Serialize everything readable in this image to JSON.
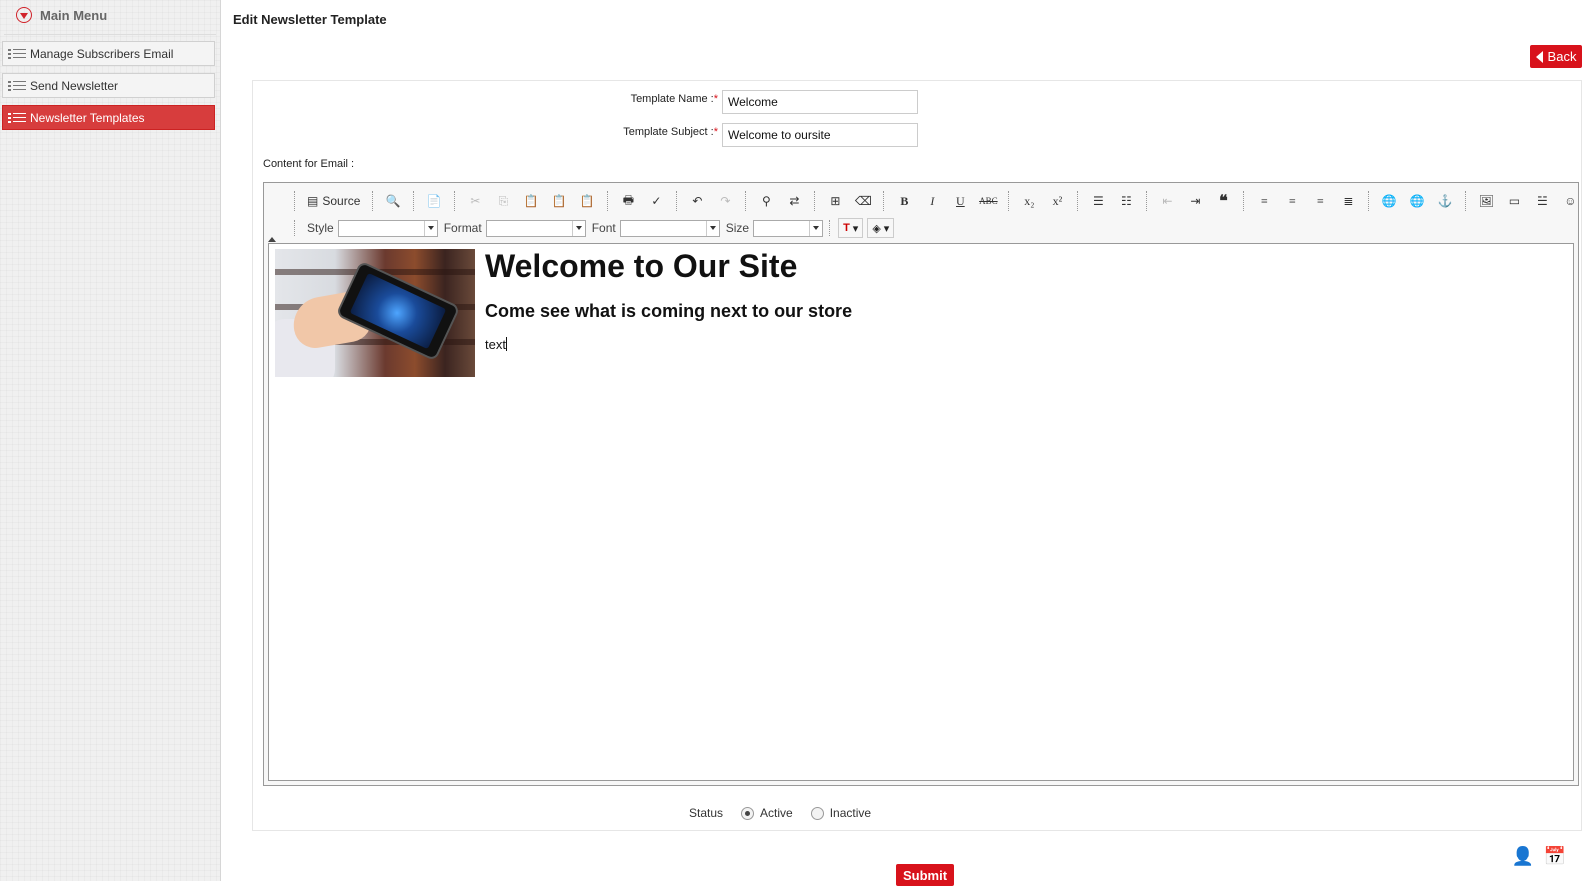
{
  "sidebar": {
    "title": "Main Menu",
    "items": [
      {
        "label": "Manage Subscribers Email",
        "active": false
      },
      {
        "label": "Send Newsletter",
        "active": false
      },
      {
        "label": "Newsletter Templates",
        "active": true
      }
    ]
  },
  "page": {
    "title": "Edit Newsletter Template",
    "back_label": "Back"
  },
  "form": {
    "template_name_label": "Template Name :",
    "template_name_value": "Welcome",
    "template_subject_label": "Template Subject :",
    "template_subject_value": "Welcome to oursite",
    "required_mark": "*",
    "content_label": "Content for Email :"
  },
  "editor": {
    "source_label": "Source",
    "style_label": "Style",
    "format_label": "Format",
    "font_label": "Font",
    "size_label": "Size",
    "content": {
      "heading": "Welcome to Our Site",
      "subheading": "Come see what is coming next to our store",
      "body": "text"
    }
  },
  "status": {
    "label": "Status",
    "options": [
      {
        "label": "Active",
        "selected": true
      },
      {
        "label": "Inactive",
        "selected": false
      }
    ]
  },
  "submit_label": "Submit",
  "colors": {
    "accent": "#d8121b",
    "active_nav": "#d73d3d"
  }
}
